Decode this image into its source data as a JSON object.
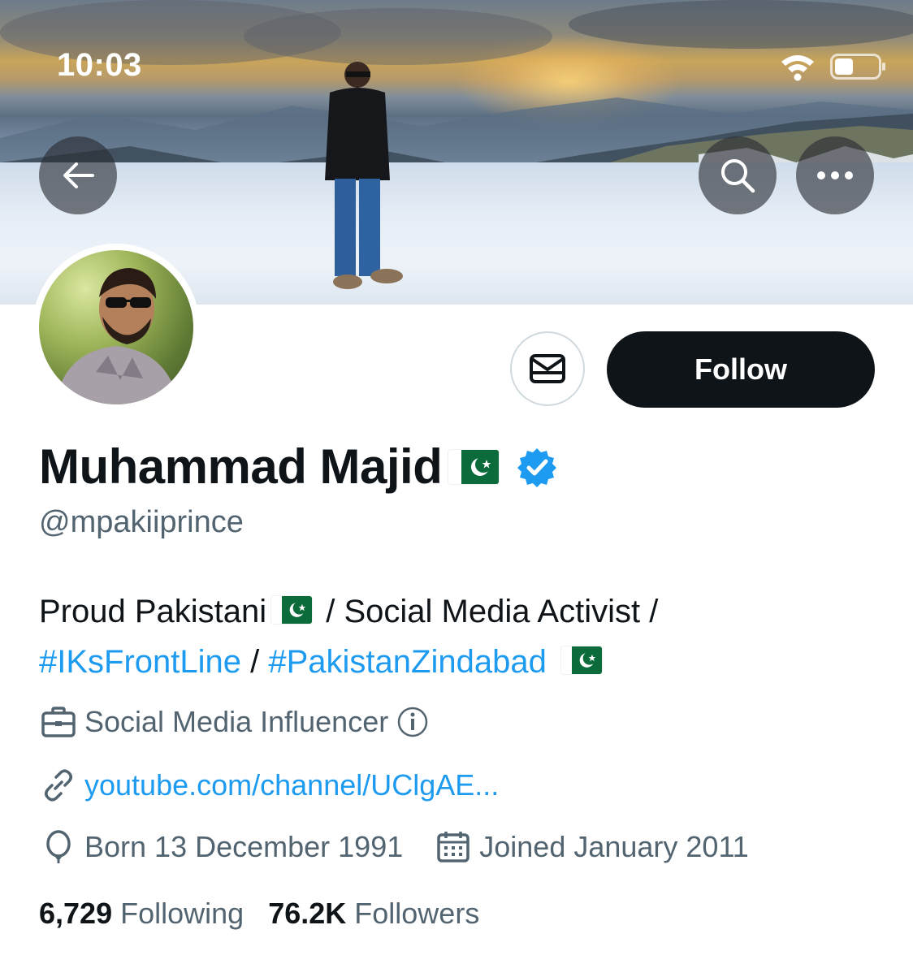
{
  "status_bar": {
    "time": "10:03",
    "wifi_icon": "wifi-icon",
    "battery_icon": "battery-icon"
  },
  "header": {
    "back_icon": "arrow-left-icon",
    "search_icon": "search-icon",
    "more_icon": "more-horizontal-icon"
  },
  "profile": {
    "display_name": "Muhammad Majid",
    "handle": "@mpakiiprince",
    "verified": true,
    "follow_label": "Follow",
    "message_icon": "envelope-icon",
    "bio": {
      "line1_a": "Proud Pakistani",
      "line1_b": " / Social Media Activist /",
      "tag1": "#IKsFrontLine",
      "sep": " / ",
      "tag2": "#PakistanZindabad"
    },
    "category": "Social Media Influencer",
    "category_info_icon": "info-icon",
    "website": "youtube.com/channel/UClgAE...",
    "born": "Born 13 December 1991",
    "joined": "Joined January 2011",
    "following_count": "6,729",
    "following_label": "Following",
    "followers_count": "76.2K",
    "followers_label": "Followers"
  },
  "colors": {
    "accent": "#1d9bf0",
    "text_primary": "#0f1419",
    "text_secondary": "#536471",
    "follow_bg": "#0f1419",
    "flag_green": "#0b6b3a"
  }
}
